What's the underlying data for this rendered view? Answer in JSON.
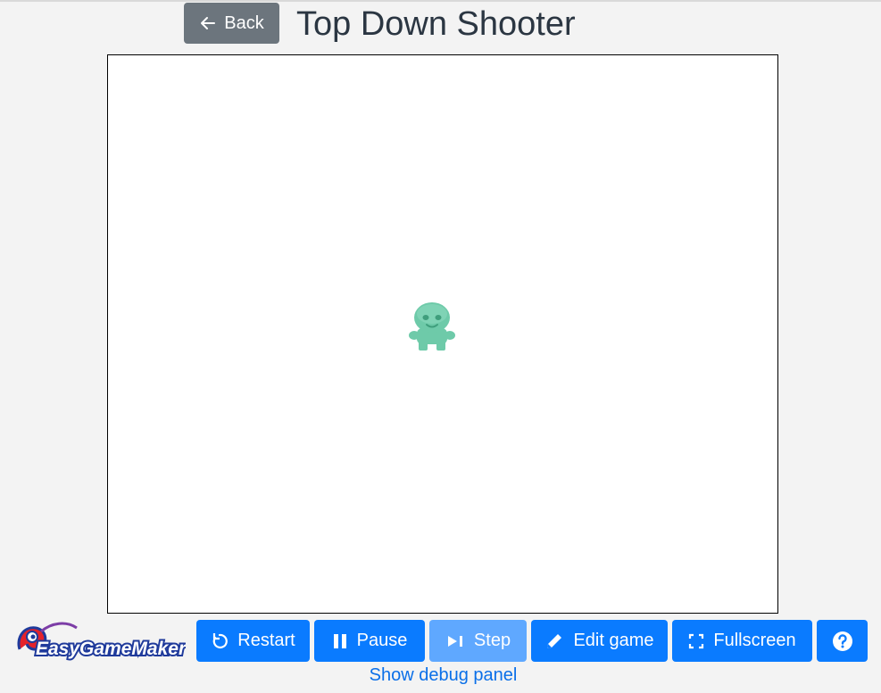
{
  "header": {
    "back_label": "Back",
    "title": "Top Down Shooter"
  },
  "game": {
    "sprite": "green-alien-player",
    "sprite_color": "#6ecaa9"
  },
  "logo": {
    "text": "EasyGameMaker"
  },
  "controls": {
    "restart_label": "Restart",
    "pause_label": "Pause",
    "step_label": "Step",
    "edit_label": "Edit game",
    "fullscreen_label": "Fullscreen",
    "help_icon": "question-circle-icon"
  },
  "footer": {
    "debug_label": "Show debug panel"
  },
  "colors": {
    "primary": "#0a7bff",
    "primary_disabled": "#5fa8ff",
    "secondary": "#6c757d",
    "link": "#0a6fe8"
  }
}
